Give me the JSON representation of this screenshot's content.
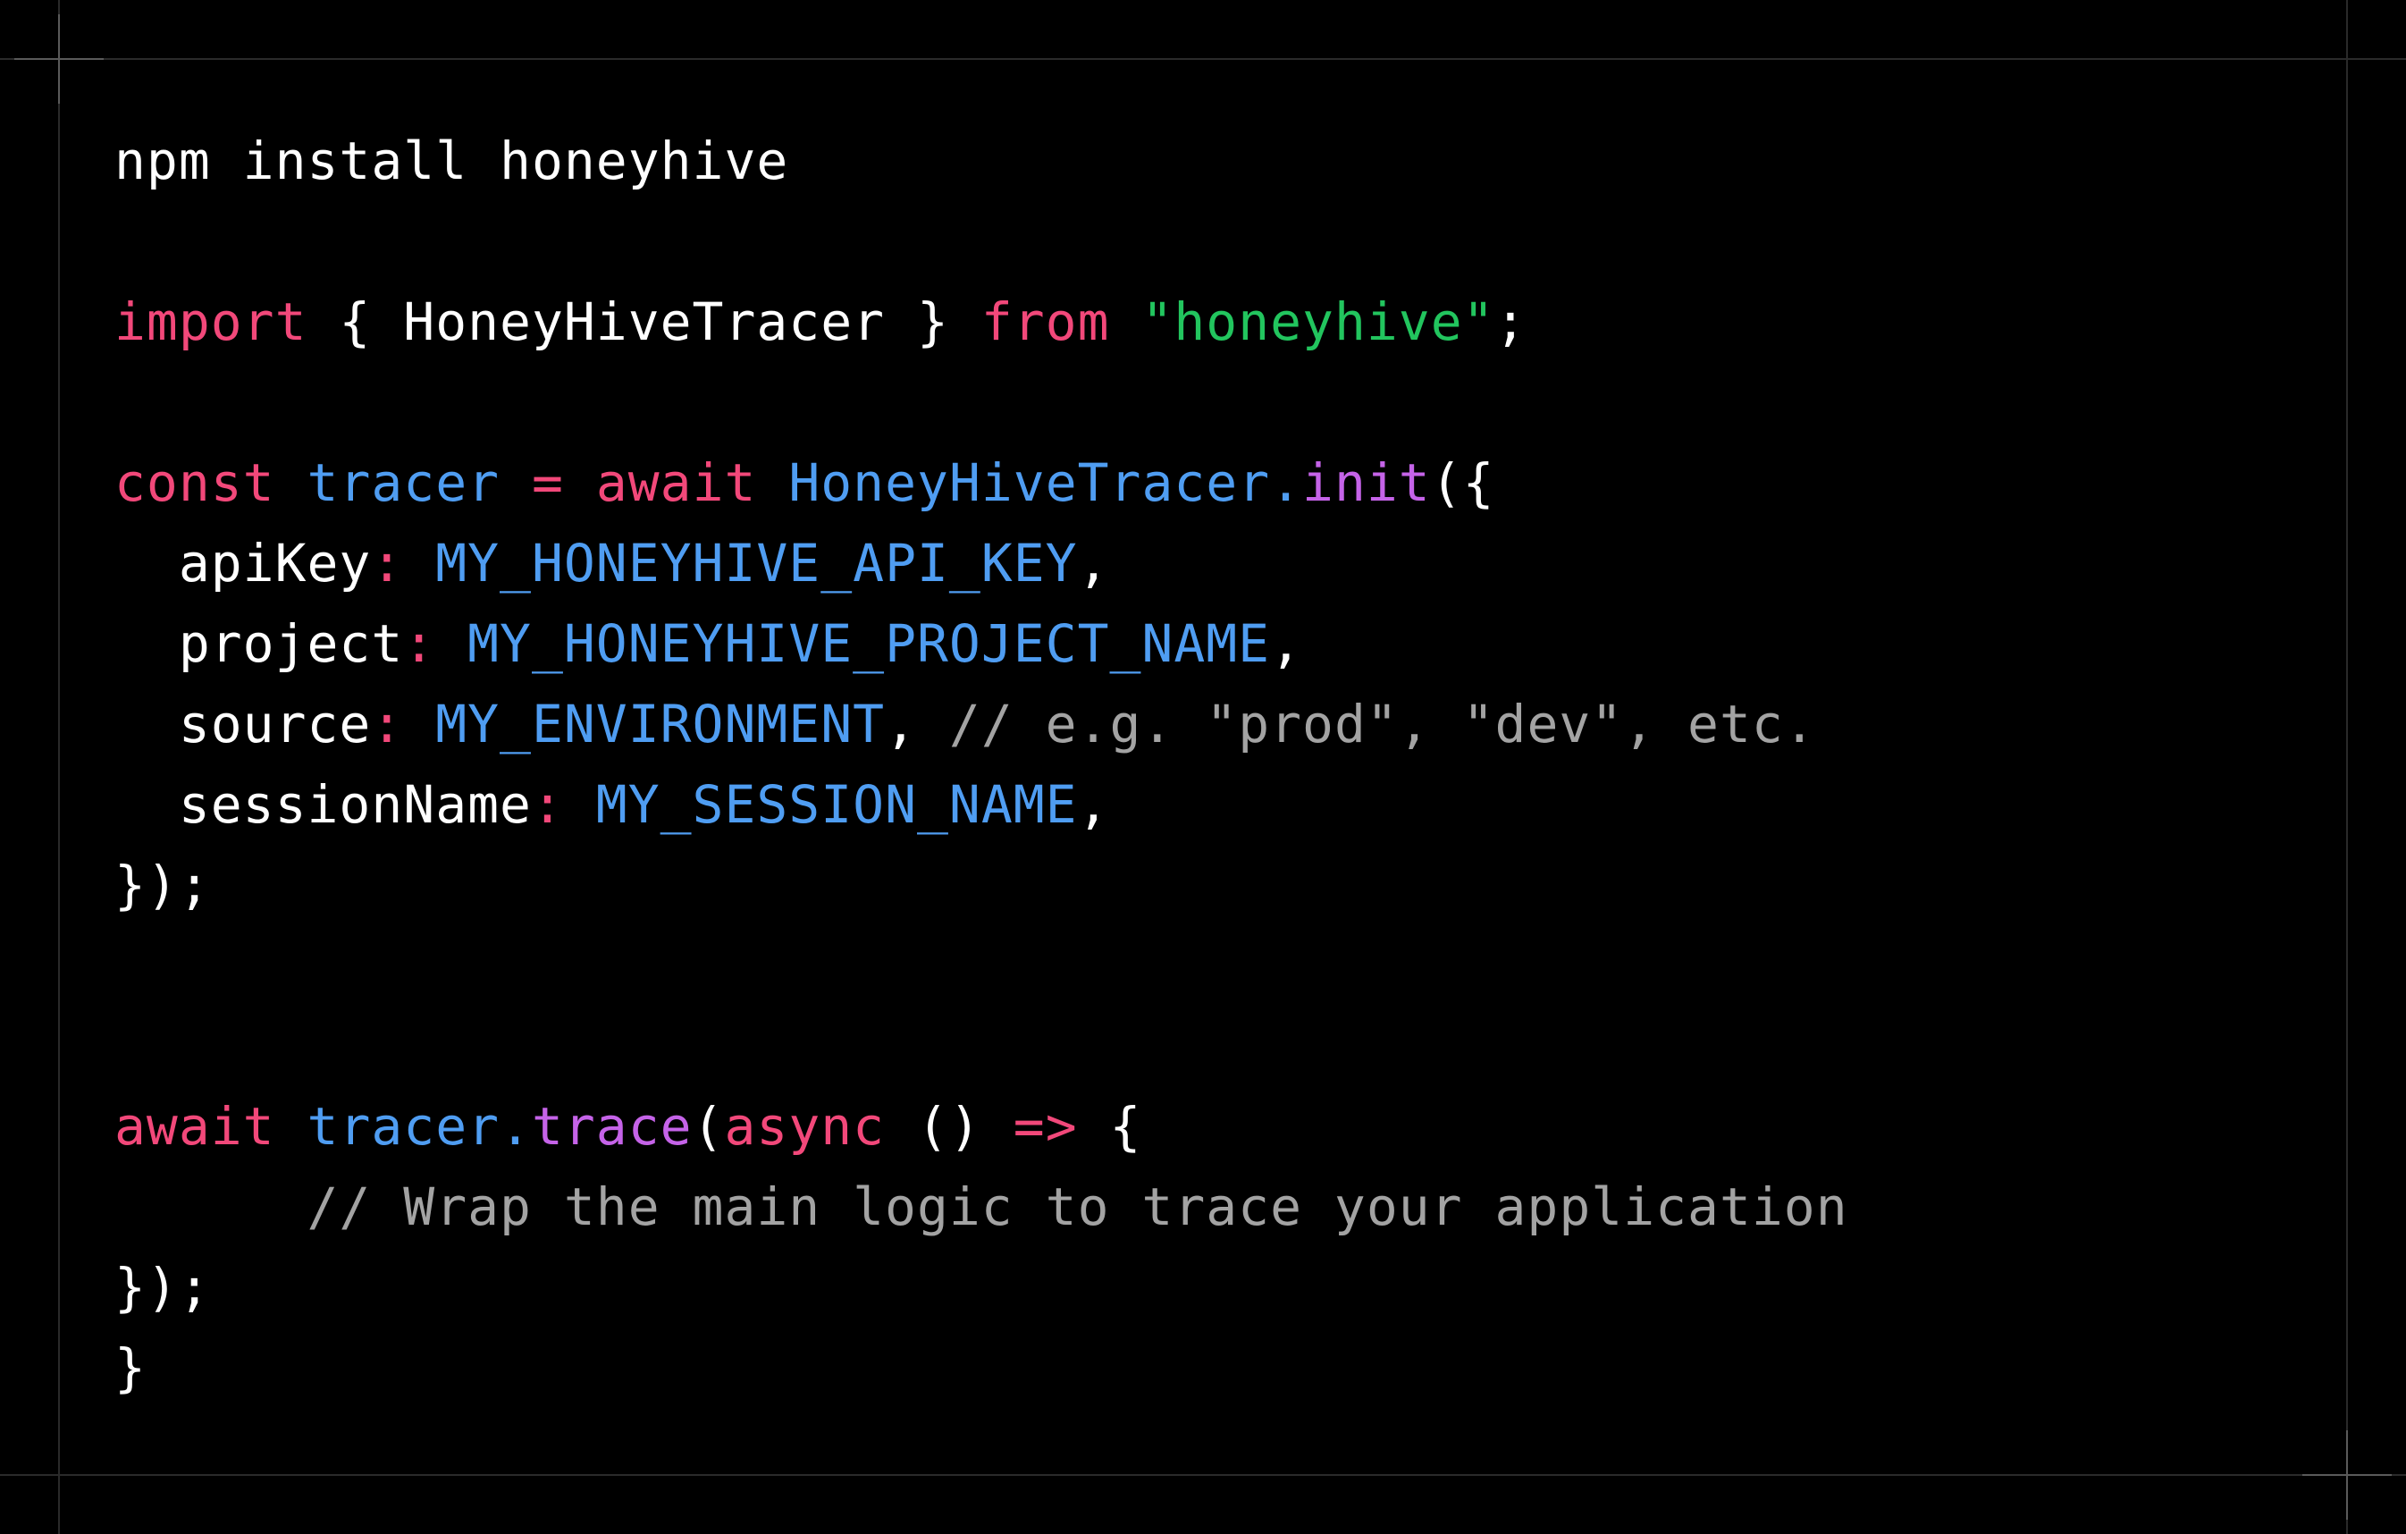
{
  "colors": {
    "background": "#000000",
    "frame_line": "#2a2a2a",
    "crosshair": "#5a5a5a",
    "plain": "#ffffff",
    "keyword": "#f2487a",
    "identifier": "#4f9df2",
    "method": "#c563e8",
    "string": "#22c55e",
    "comment": "#a3a3a3"
  },
  "code_lines": [
    [
      {
        "text": "npm install honeyhive",
        "type": "plain"
      }
    ],
    [
      {
        "text": "import",
        "type": "keyword"
      },
      {
        "text": " { HoneyHiveTracer } ",
        "type": "plain"
      },
      {
        "text": "from",
        "type": "keyword"
      },
      {
        "text": " ",
        "type": "plain"
      },
      {
        "text": "\"honeyhive\"",
        "type": "string"
      },
      {
        "text": ";",
        "type": "plain"
      }
    ],
    [
      {
        "text": "const",
        "type": "keyword"
      },
      {
        "text": " ",
        "type": "plain"
      },
      {
        "text": "tracer",
        "type": "identifier"
      },
      {
        "text": " ",
        "type": "plain"
      },
      {
        "text": "=",
        "type": "keyword"
      },
      {
        "text": " ",
        "type": "plain"
      },
      {
        "text": "await",
        "type": "keyword"
      },
      {
        "text": " ",
        "type": "plain"
      },
      {
        "text": "HoneyHiveTracer.",
        "type": "identifier"
      },
      {
        "text": "init",
        "type": "method"
      },
      {
        "text": "({",
        "type": "plain"
      }
    ],
    [
      {
        "text": "  apiKey",
        "type": "plain"
      },
      {
        "text": ":",
        "type": "keyword"
      },
      {
        "text": " ",
        "type": "plain"
      },
      {
        "text": "MY_HONEYHIVE_API_KEY",
        "type": "identifier"
      },
      {
        "text": ",",
        "type": "plain"
      }
    ],
    [
      {
        "text": "  project",
        "type": "plain"
      },
      {
        "text": ":",
        "type": "keyword"
      },
      {
        "text": " ",
        "type": "plain"
      },
      {
        "text": "MY_HONEYHIVE_PROJECT_NAME",
        "type": "identifier"
      },
      {
        "text": ",",
        "type": "plain"
      }
    ],
    [
      {
        "text": "  source",
        "type": "plain"
      },
      {
        "text": ":",
        "type": "keyword"
      },
      {
        "text": " ",
        "type": "plain"
      },
      {
        "text": "MY_ENVIRONMENT",
        "type": "identifier"
      },
      {
        "text": ", ",
        "type": "plain"
      },
      {
        "text": "// e.g. \"prod\", \"dev\", etc.",
        "type": "comment"
      }
    ],
    [
      {
        "text": "  sessionName",
        "type": "plain"
      },
      {
        "text": ":",
        "type": "keyword"
      },
      {
        "text": " ",
        "type": "plain"
      },
      {
        "text": "MY_SESSION_NAME",
        "type": "identifier"
      },
      {
        "text": ",",
        "type": "plain"
      }
    ],
    [
      {
        "text": "});",
        "type": "plain"
      }
    ],
    [
      {
        "text": "await",
        "type": "keyword"
      },
      {
        "text": " ",
        "type": "plain"
      },
      {
        "text": "tracer.",
        "type": "identifier"
      },
      {
        "text": "trace",
        "type": "method"
      },
      {
        "text": "(",
        "type": "plain"
      },
      {
        "text": "async",
        "type": "keyword"
      },
      {
        "text": " () ",
        "type": "plain"
      },
      {
        "text": "=>",
        "type": "keyword"
      },
      {
        "text": " {",
        "type": "plain"
      }
    ],
    [
      {
        "text": "      // Wrap the main logic to trace your application",
        "type": "comment"
      }
    ],
    [
      {
        "text": "});",
        "type": "plain"
      }
    ],
    [
      {
        "text": "}",
        "type": "plain"
      }
    ]
  ]
}
